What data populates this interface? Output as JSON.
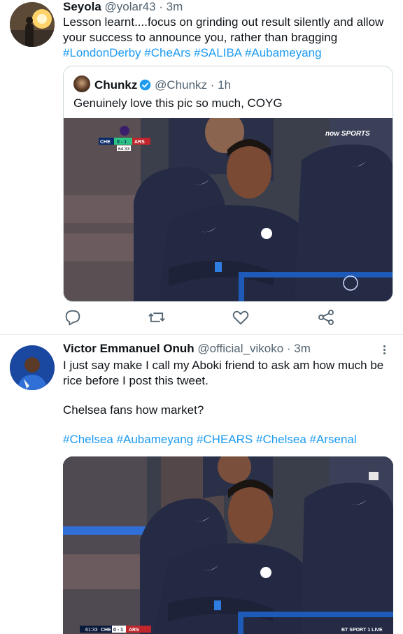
{
  "tweets": [
    {
      "author_name": "Seyola",
      "handle": "@yolar43",
      "time": "· 3m",
      "text_line1": "Lesson learnt....focus on grinding out result silently and allow",
      "text_line2": "your success to announce you, rather than bragging",
      "hashtags": [
        "#LondonDerby",
        "#CheArs",
        "#SALIBA",
        "#Aubameyang"
      ],
      "quoted": {
        "author_name": "Chunkz",
        "handle": "@Chunkz",
        "time": "· 1h",
        "text": "Genuinely love this pic so much, COYG",
        "photo_overlay": {
          "broadcaster": "now SPORTS",
          "score_home": "CHE",
          "score": "0 - 1",
          "score_away": "ARS",
          "clock": "64:33"
        }
      },
      "actions": [
        "reply-icon",
        "retweet-icon",
        "like-icon",
        "share-icon"
      ]
    },
    {
      "author_name": "Victor Emmanuel Onuh",
      "handle": "@official_vikoko",
      "time": "· 3m",
      "text_line1": "I just say make I call my Aboki friend to ask am how much be",
      "text_line2": "rice before I post this tweet.",
      "text_line3": "Chelsea fans how market?",
      "hashtags": [
        "#Chelsea",
        "#Aubameyang",
        "#CHEARS",
        "#Chelsea",
        "#Arsenal"
      ],
      "photo_overlay": {
        "clock": "61:33",
        "score_home": "CHE",
        "score": "0 - 1",
        "score_away": "ARS",
        "broadcaster": "BT SPORT 1 LIVE"
      }
    }
  ],
  "colors": {
    "link": "#1d9bf0",
    "secondary_text": "#536471",
    "border": "#cfd9de",
    "jacket": "#242a44"
  }
}
